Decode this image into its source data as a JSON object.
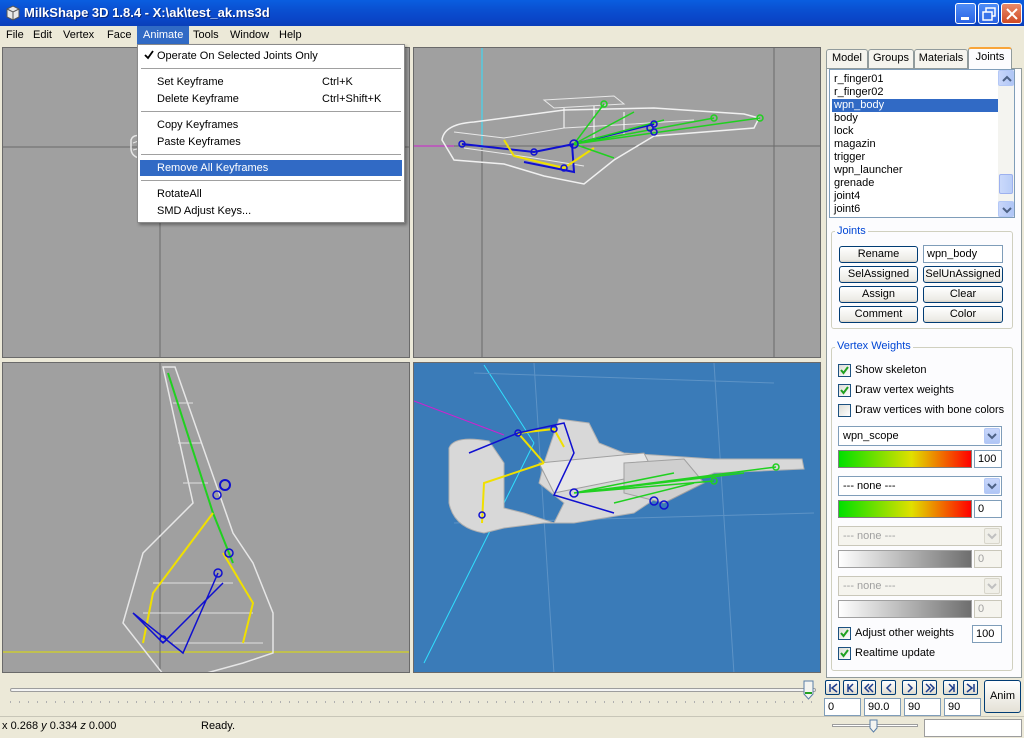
{
  "window": {
    "title": "MilkShape 3D 1.8.4 - X:\\ak\\test_ak.ms3d"
  },
  "menubar": {
    "items": [
      {
        "label": "File"
      },
      {
        "label": "Edit"
      },
      {
        "label": "Vertex"
      },
      {
        "label": "Face"
      },
      {
        "label": "Animate",
        "active": true
      },
      {
        "label": "Tools"
      },
      {
        "label": "Window"
      },
      {
        "label": "Help"
      }
    ]
  },
  "animate_menu": {
    "items": [
      {
        "label": "Operate On Selected Joints Only",
        "checked": true,
        "shortcut": ""
      },
      {
        "label": "Set Keyframe",
        "shortcut": "Ctrl+K"
      },
      {
        "label": "Delete Keyframe",
        "shortcut": "Ctrl+Shift+K"
      },
      {
        "label": "Copy Keyframes",
        "shortcut": ""
      },
      {
        "label": "Paste Keyframes",
        "shortcut": ""
      },
      {
        "label": "Remove All Keyframes",
        "shortcut": "",
        "highlighted": true
      },
      {
        "label": "RotateAll",
        "shortcut": ""
      },
      {
        "label": "SMD Adjust Keys...",
        "shortcut": ""
      }
    ]
  },
  "tabs": [
    {
      "label": "Model"
    },
    {
      "label": "Groups"
    },
    {
      "label": "Materials"
    },
    {
      "label": "Joints",
      "active": true
    }
  ],
  "joints_list": {
    "items": [
      "r_finger01",
      "r_finger02",
      "wpn_body",
      "body",
      "lock",
      "magazin",
      "trigger",
      "wpn_launcher",
      "grenade",
      "joint4",
      "joint6"
    ],
    "selected": "wpn_body"
  },
  "joints_group": {
    "label": "Joints",
    "rename_label": "Rename",
    "name_value": "wpn_body",
    "selassigned_label": "SelAssigned",
    "selunassigned_label": "SelUnAssigned",
    "assign_label": "Assign",
    "clear_label": "Clear",
    "comment_label": "Comment",
    "color_label": "Color"
  },
  "vertex_weights": {
    "label": "Vertex Weights",
    "show_skeleton": {
      "label": "Show skeleton",
      "checked": true
    },
    "draw_vertex_weights": {
      "label": "Draw vertex weights",
      "checked": true
    },
    "draw_bone_colors": {
      "label": "Draw vertices with bone colors",
      "checked": false
    },
    "bone1": {
      "value": "wpn_scope",
      "weight": "100"
    },
    "bone2": {
      "value": "--- none ---",
      "weight": "0"
    },
    "bone3": {
      "value": "--- none ---",
      "weight": "0"
    },
    "bone4": {
      "value": "--- none ---",
      "weight": "0"
    },
    "adjust_other": {
      "label": "Adjust other weights",
      "checked": true,
      "value": "100"
    },
    "realtime_update": {
      "label": "Realtime update",
      "checked": true
    }
  },
  "anim_controls": {
    "frame_fields": [
      "0",
      "90.0",
      "90",
      "90"
    ],
    "anim_label": "Anim"
  },
  "statusbar": {
    "coord_x": "0.268",
    "coord_y": "0.334",
    "coord_z": "0.000",
    "status": "Ready."
  },
  "colors": {
    "selection": "#316ac5",
    "viewport_gray": "#a0a0a0",
    "viewport_3d": "#3a7bb8",
    "bone_blue": "#1010d0",
    "bone_green": "#20d020",
    "bone_yellow": "#f0e000"
  }
}
